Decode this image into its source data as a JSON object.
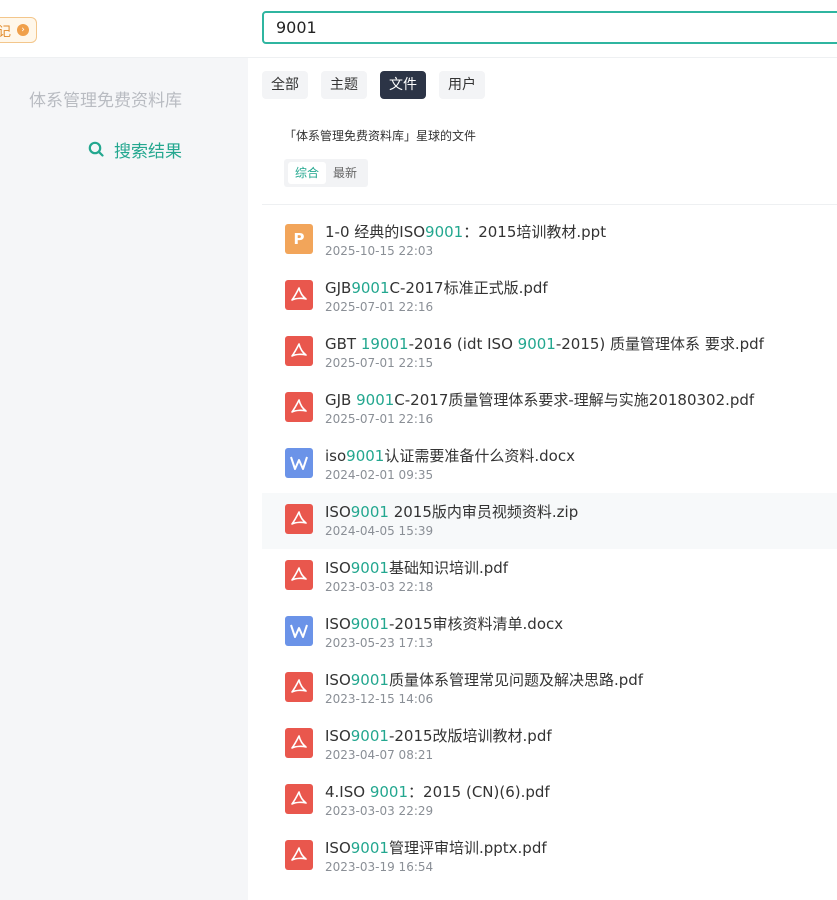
{
  "topbar": {
    "badge_text": "记",
    "badge_icon": "arrow-circle-icon",
    "search_value": "9001"
  },
  "sidebar": {
    "title": "体系管理免费资料库",
    "item_label": "搜索结果",
    "accent": "#23a78f"
  },
  "tabs": [
    {
      "label": "全部",
      "active": false
    },
    {
      "label": "主题",
      "active": false
    },
    {
      "label": "文件",
      "active": true
    },
    {
      "label": "用户",
      "active": false
    }
  ],
  "group": {
    "title": "「体系管理免费资料库」星球的文件",
    "sort_options": [
      {
        "label": "综合",
        "active": true
      },
      {
        "label": "最新",
        "active": false
      }
    ]
  },
  "files": [
    {
      "type": "ppt",
      "name_parts": [
        [
          "1-0 经典的ISO",
          false
        ],
        [
          "9001",
          true
        ],
        [
          "：2015培训教材.ppt",
          false
        ]
      ],
      "date": "2025-10-15 22:03"
    },
    {
      "type": "pdf",
      "name_parts": [
        [
          "GJB",
          false
        ],
        [
          "9001",
          true
        ],
        [
          "C-2017标准正式版.pdf",
          false
        ]
      ],
      "date": "2025-07-01 22:16"
    },
    {
      "type": "pdf",
      "name_parts": [
        [
          "GBT ",
          false
        ],
        [
          "19001",
          true
        ],
        [
          "-2016 (idt ISO ",
          false
        ],
        [
          "9001",
          true
        ],
        [
          "-2015) 质量管理体系 要求.pdf",
          false
        ]
      ],
      "date": "2025-07-01 22:15"
    },
    {
      "type": "pdf",
      "name_parts": [
        [
          "GJB ",
          false
        ],
        [
          "9001",
          true
        ],
        [
          "C-2017质量管理体系要求-理解与实施20180302.pdf",
          false
        ]
      ],
      "date": "2025-07-01 22:16"
    },
    {
      "type": "doc",
      "name_parts": [
        [
          "iso",
          false
        ],
        [
          "9001",
          true
        ],
        [
          "认证需要准备什么资料.docx",
          false
        ]
      ],
      "date": "2024-02-01 09:35"
    },
    {
      "type": "pdf",
      "name_parts": [
        [
          "ISO",
          false
        ],
        [
          "9001",
          true
        ],
        [
          " 2015版内审员视频资料.zip",
          false
        ]
      ],
      "date": "2024-04-05 15:39"
    },
    {
      "type": "pdf",
      "name_parts": [
        [
          "ISO",
          false
        ],
        [
          "9001",
          true
        ],
        [
          "基础知识培训.pdf",
          false
        ]
      ],
      "date": "2023-03-03 22:18"
    },
    {
      "type": "doc",
      "name_parts": [
        [
          "ISO",
          false
        ],
        [
          "9001",
          true
        ],
        [
          "-2015审核资料清单.docx",
          false
        ]
      ],
      "date": "2023-05-23 17:13"
    },
    {
      "type": "pdf",
      "name_parts": [
        [
          "ISO",
          false
        ],
        [
          "9001",
          true
        ],
        [
          "质量体系管理常见问题及解决思路.pdf",
          false
        ]
      ],
      "date": "2023-12-15 14:06"
    },
    {
      "type": "pdf",
      "name_parts": [
        [
          "ISO",
          false
        ],
        [
          "9001",
          true
        ],
        [
          "-2015改版培训教材.pdf",
          false
        ]
      ],
      "date": "2023-04-07 08:21"
    },
    {
      "type": "pdf",
      "name_parts": [
        [
          "4.ISO ",
          false
        ],
        [
          "9001",
          true
        ],
        [
          "：2015 (CN)(6).pdf",
          false
        ]
      ],
      "date": "2023-03-03 22:29"
    },
    {
      "type": "pdf",
      "name_parts": [
        [
          "ISO",
          false
        ],
        [
          "9001",
          true
        ],
        [
          "管理评审培训.pptx.pdf",
          false
        ]
      ],
      "date": "2023-03-19 16:54"
    }
  ]
}
